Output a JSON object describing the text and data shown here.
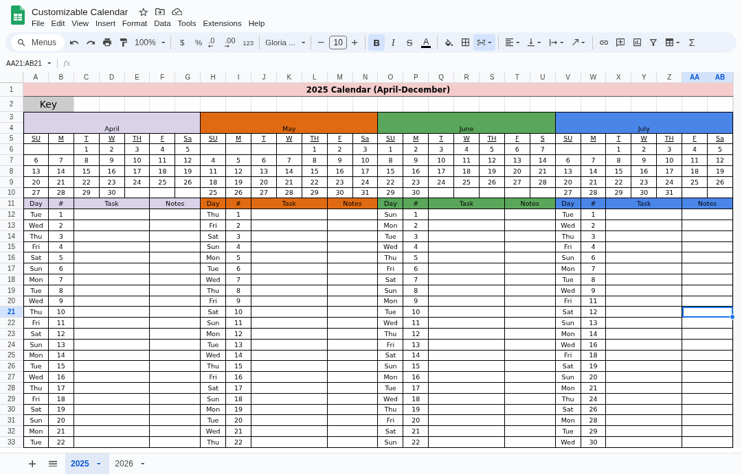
{
  "document": {
    "title": "Customizable Calendar"
  },
  "menu_bar": [
    "File",
    "Edit",
    "View",
    "Insert",
    "Format",
    "Data",
    "Tools",
    "Extensions",
    "Help"
  ],
  "toolbar": {
    "search": {
      "placeholder": "Menus"
    },
    "zoom": "100%",
    "currency": "$",
    "percent": "%",
    "decrease_decimal": ".0",
    "increase_decimal": ".00",
    "number_format": "123",
    "font": "Gloria ...",
    "font_size": "10",
    "bold": {
      "label": "B",
      "on": true
    },
    "italic": {
      "label": "I",
      "on": false
    },
    "strikethrough": {
      "label": "S",
      "on": false
    },
    "text_color": {
      "label": "A"
    },
    "merge_cells": {
      "on": true
    },
    "functions": "Σ"
  },
  "formula_bar": {
    "name_box": "AA21:AB21",
    "function_label": "fx"
  },
  "sheet": {
    "column_headers": [
      {
        "label": "A",
        "selected": false
      },
      {
        "label": "B",
        "selected": false
      },
      {
        "label": "C",
        "selected": false
      },
      {
        "label": "D",
        "selected": false
      },
      {
        "label": "E",
        "selected": false
      },
      {
        "label": "F",
        "selected": false
      },
      {
        "label": "G",
        "selected": false
      },
      {
        "label": "H",
        "selected": false
      },
      {
        "label": "I",
        "selected": false
      },
      {
        "label": "J",
        "selected": false
      },
      {
        "label": "K",
        "selected": false
      },
      {
        "label": "L",
        "selected": false
      },
      {
        "label": "M",
        "selected": false
      },
      {
        "label": "N",
        "selected": false
      },
      {
        "label": "O",
        "selected": false
      },
      {
        "label": "P",
        "selected": false
      },
      {
        "label": "Q",
        "selected": false
      },
      {
        "label": "R",
        "selected": false
      },
      {
        "label": "S",
        "selected": false
      },
      {
        "label": "T",
        "selected": false
      },
      {
        "label": "U",
        "selected": false
      },
      {
        "label": "V",
        "selected": false
      },
      {
        "label": "W",
        "selected": false
      },
      {
        "label": "X",
        "selected": false
      },
      {
        "label": "Y",
        "selected": false
      },
      {
        "label": "Z",
        "selected": false
      },
      {
        "label": "AA",
        "selected": true
      },
      {
        "label": "AB",
        "selected": true
      }
    ],
    "row_headers": [
      {
        "label": "1",
        "selected": false
      },
      {
        "label": "2",
        "selected": false
      },
      {
        "label": "3",
        "selected": false
      },
      {
        "label": "4",
        "selected": false
      },
      {
        "label": "5",
        "selected": false
      },
      {
        "label": "6",
        "selected": false
      },
      {
        "label": "7",
        "selected": false
      },
      {
        "label": "8",
        "selected": false
      },
      {
        "label": "9",
        "selected": false
      },
      {
        "label": "10",
        "selected": false
      },
      {
        "label": "11",
        "selected": false
      },
      {
        "label": "12",
        "selected": false
      },
      {
        "label": "13",
        "selected": false
      },
      {
        "label": "14",
        "selected": false
      },
      {
        "label": "15",
        "selected": false
      },
      {
        "label": "16",
        "selected": false
      },
      {
        "label": "17",
        "selected": false
      },
      {
        "label": "18",
        "selected": false
      },
      {
        "label": "19",
        "selected": false
      },
      {
        "label": "20",
        "selected": false
      },
      {
        "label": "21",
        "selected": true
      },
      {
        "label": "22",
        "selected": false
      },
      {
        "label": "23",
        "selected": false
      },
      {
        "label": "24",
        "selected": false
      },
      {
        "label": "25",
        "selected": false
      },
      {
        "label": "26",
        "selected": false
      },
      {
        "label": "27",
        "selected": false
      },
      {
        "label": "28",
        "selected": false
      },
      {
        "label": "29",
        "selected": false
      },
      {
        "label": "30",
        "selected": false
      },
      {
        "label": "31",
        "selected": false
      },
      {
        "label": "32",
        "selected": false
      },
      {
        "label": "33",
        "selected": false
      }
    ],
    "title": "2025 Calendar (April-December)",
    "key": "Key",
    "months": [
      {
        "name": "April",
        "color": "#d9d2e9",
        "weekdays": [
          "SU",
          "M",
          "T",
          "W",
          "TH",
          "F",
          "Sa"
        ],
        "weeks": [
          [
            "1",
            "2",
            "3",
            "4",
            "5"
          ],
          [
            "6",
            "7",
            "8",
            "9",
            "10",
            "11",
            "12"
          ],
          [
            "13",
            "14",
            "15",
            "16",
            "17",
            "18",
            "19"
          ],
          [
            "20",
            "21",
            "22",
            "23",
            "24",
            "25",
            "26"
          ],
          [
            "27",
            "28",
            "29",
            "30"
          ]
        ],
        "table_header": {
          "day": "Day",
          "number": "#",
          "task": "Task",
          "notes": "Notes"
        },
        "entries": [
          {
            "day": "Tue",
            "date": "1",
            "selected": false
          },
          {
            "day": "Wed",
            "date": "2",
            "selected": false
          },
          {
            "day": "Thu",
            "date": "3",
            "selected": false
          },
          {
            "day": "Fri",
            "date": "4",
            "selected": false
          },
          {
            "day": "Sat",
            "date": "5",
            "selected": false
          },
          {
            "day": "Sun",
            "date": "6",
            "selected": false
          },
          {
            "day": "Mon",
            "date": "7",
            "selected": false
          },
          {
            "day": "Tue",
            "date": "8",
            "selected": false
          },
          {
            "day": "Wed",
            "date": "9",
            "selected": false
          },
          {
            "day": "Thu",
            "date": "10",
            "selected": false
          },
          {
            "day": "Fri",
            "date": "11",
            "selected": false
          },
          {
            "day": "Sat",
            "date": "12",
            "selected": false
          },
          {
            "day": "Sun",
            "date": "13",
            "selected": false
          },
          {
            "day": "Mon",
            "date": "14",
            "selected": false
          },
          {
            "day": "Tue",
            "date": "15",
            "selected": false
          },
          {
            "day": "Wed",
            "date": "16",
            "selected": false
          },
          {
            "day": "Thu",
            "date": "17",
            "selected": false
          },
          {
            "day": "Fri",
            "date": "18",
            "selected": false
          },
          {
            "day": "Sat",
            "date": "19",
            "selected": false
          },
          {
            "day": "Sun",
            "date": "20",
            "selected": false
          },
          {
            "day": "Mon",
            "date": "21",
            "selected": false
          },
          {
            "day": "Tue",
            "date": "22",
            "selected": false
          }
        ]
      },
      {
        "name": "May",
        "color": "#e06a12",
        "weekdays": [
          "SU",
          "M",
          "T",
          "W",
          "TH",
          "F",
          "Sa"
        ],
        "weeks": [
          [
            "1",
            "2",
            "3"
          ],
          [
            "4",
            "5",
            "6",
            "7",
            "8",
            "9",
            "10"
          ],
          [
            "11",
            "12",
            "13",
            "14",
            "15",
            "16",
            "17"
          ],
          [
            "18",
            "19",
            "20",
            "21",
            "22",
            "23",
            "24"
          ],
          [
            "25",
            "26",
            "27",
            "28",
            "29",
            "30",
            "31"
          ]
        ],
        "table_header": {
          "day": "Day",
          "number": "#",
          "task": "Task",
          "notes": "Notes"
        },
        "entries": [
          {
            "day": "Thu",
            "date": "1",
            "selected": false
          },
          {
            "day": "Fri",
            "date": "2",
            "selected": false
          },
          {
            "day": "Sat",
            "date": "3",
            "selected": false
          },
          {
            "day": "Sun",
            "date": "4",
            "selected": false
          },
          {
            "day": "Mon",
            "date": "5",
            "selected": false
          },
          {
            "day": "Tue",
            "date": "6",
            "selected": false
          },
          {
            "day": "Wed",
            "date": "7",
            "selected": false
          },
          {
            "day": "Thu",
            "date": "8",
            "selected": false
          },
          {
            "day": "Fri",
            "date": "9",
            "selected": false
          },
          {
            "day": "Sat",
            "date": "10",
            "selected": false
          },
          {
            "day": "Sun",
            "date": "11",
            "selected": false
          },
          {
            "day": "Mon",
            "date": "12",
            "selected": false
          },
          {
            "day": "Tue",
            "date": "13",
            "selected": false
          },
          {
            "day": "Wed",
            "date": "14",
            "selected": false
          },
          {
            "day": "Thu",
            "date": "15",
            "selected": false
          },
          {
            "day": "Fri",
            "date": "16",
            "selected": false
          },
          {
            "day": "Sat",
            "date": "17",
            "selected": false
          },
          {
            "day": "Sun",
            "date": "18",
            "selected": false
          },
          {
            "day": "Mon",
            "date": "19",
            "selected": false
          },
          {
            "day": "Tue",
            "date": "20",
            "selected": false
          },
          {
            "day": "Wed",
            "date": "21",
            "selected": false
          },
          {
            "day": "Thu",
            "date": "22",
            "selected": false
          }
        ]
      },
      {
        "name": "June",
        "color": "#5aa65a",
        "weekdays": [
          "SU",
          "M",
          "T",
          "W",
          "TH",
          "F",
          "S"
        ],
        "weeks": [
          [
            "1",
            "2",
            "3",
            "4",
            "5",
            "6",
            "7"
          ],
          [
            "8",
            "9",
            "10",
            "11",
            "12",
            "13",
            "14"
          ],
          [
            "15",
            "16",
            "17",
            "18",
            "19",
            "20",
            "21"
          ],
          [
            "22",
            "23",
            "24",
            "25",
            "26",
            "27",
            "28"
          ],
          [
            "29",
            "30"
          ]
        ],
        "table_header": {
          "day": "Day",
          "number": "#",
          "task": "Task",
          "notes": "Notes"
        },
        "entries": [
          {
            "day": "Sun",
            "date": "1",
            "selected": false
          },
          {
            "day": "Mon",
            "date": "2",
            "selected": false
          },
          {
            "day": "Tue",
            "date": "3",
            "selected": false
          },
          {
            "day": "Wed",
            "date": "4",
            "selected": false
          },
          {
            "day": "Thu",
            "date": "5",
            "selected": false
          },
          {
            "day": "Fri",
            "date": "6",
            "selected": false
          },
          {
            "day": "Sat",
            "date": "7",
            "selected": false
          },
          {
            "day": "Sun",
            "date": "8",
            "selected": false
          },
          {
            "day": "Mon",
            "date": "9",
            "selected": false
          },
          {
            "day": "Tue",
            "date": "10",
            "selected": false
          },
          {
            "day": "Wed",
            "date": "11",
            "selected": false
          },
          {
            "day": "Thu",
            "date": "12",
            "selected": false
          },
          {
            "day": "Fri",
            "date": "13",
            "selected": false
          },
          {
            "day": "Sat",
            "date": "14",
            "selected": false
          },
          {
            "day": "Sun",
            "date": "15",
            "selected": false
          },
          {
            "day": "Mon",
            "date": "16",
            "selected": false
          },
          {
            "day": "Tue",
            "date": "17",
            "selected": false
          },
          {
            "day": "Wed",
            "date": "18",
            "selected": false
          },
          {
            "day": "Thu",
            "date": "19",
            "selected": false
          },
          {
            "day": "Fri",
            "date": "20",
            "selected": false
          },
          {
            "day": "Sat",
            "date": "21",
            "selected": false
          },
          {
            "day": "Sun",
            "date": "22",
            "selected": false
          }
        ]
      },
      {
        "name": "July",
        "color": "#4a86e8",
        "weekdays": [
          "SU",
          "M",
          "T",
          "W",
          "TH",
          "F",
          "Sa"
        ],
        "weeks": [
          [
            "1",
            "2",
            "3",
            "4",
            "5"
          ],
          [
            "6",
            "7",
            "8",
            "9",
            "10",
            "11",
            "12"
          ],
          [
            "13",
            "14",
            "15",
            "16",
            "17",
            "18",
            "19"
          ],
          [
            "20",
            "21",
            "22",
            "23",
            "24",
            "25",
            "26"
          ],
          [
            "27",
            "28",
            "29",
            "30",
            "31"
          ]
        ],
        "table_header": {
          "day": "Day",
          "number": "#",
          "task": "Task",
          "notes": "Notes"
        },
        "entries": [
          {
            "day": "Tue",
            "date": "1",
            "selected": false
          },
          {
            "day": "Wed",
            "date": "2",
            "selected": false
          },
          {
            "day": "Thu",
            "date": "3",
            "selected": false
          },
          {
            "day": "Fri",
            "date": "4",
            "selected": false
          },
          {
            "day": "Sun",
            "date": "6",
            "selected": false
          },
          {
            "day": "Mon",
            "date": "7",
            "selected": false
          },
          {
            "day": "Tue",
            "date": "8",
            "selected": false
          },
          {
            "day": "Wed",
            "date": "9",
            "selected": false
          },
          {
            "day": "Fri",
            "date": "11",
            "selected": false
          },
          {
            "day": "Sat",
            "date": "12",
            "selected": true
          },
          {
            "day": "Sun",
            "date": "13",
            "selected": false
          },
          {
            "day": "Mon",
            "date": "14",
            "selected": false
          },
          {
            "day": "Wed",
            "date": "16",
            "selected": false
          },
          {
            "day": "Fri",
            "date": "18",
            "selected": false
          },
          {
            "day": "Sat",
            "date": "19",
            "selected": false
          },
          {
            "day": "Sun",
            "date": "20",
            "selected": false
          },
          {
            "day": "Mon",
            "date": "21",
            "selected": false
          },
          {
            "day": "Thu",
            "date": "24",
            "selected": false
          },
          {
            "day": "Sat",
            "date": "26",
            "selected": false
          },
          {
            "day": "Mon",
            "date": "28",
            "selected": false
          },
          {
            "day": "Tue",
            "date": "29",
            "selected": false
          },
          {
            "day": "Wed",
            "date": "30",
            "selected": false
          }
        ]
      }
    ]
  },
  "sheet_tabs": [
    {
      "label": "2025",
      "selected": true
    },
    {
      "label": "2026",
      "selected": false
    }
  ]
}
